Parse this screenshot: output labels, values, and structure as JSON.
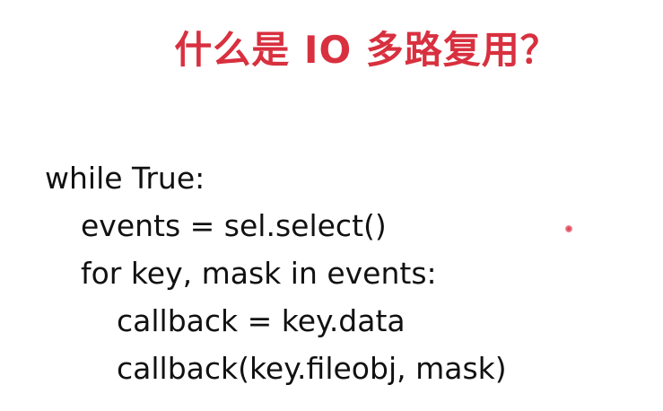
{
  "slide": {
    "title": "什么是 IO 多路复用？",
    "code_lines": [
      "while True:",
      "events = sel.select()",
      "for key, mask in events:",
      "callback = key.data",
      "callback(key.fileobj, mask)"
    ],
    "colors": {
      "title": "#d8303f",
      "text": "#111111",
      "background": "#ffffff",
      "pointer": "#e0304a"
    }
  }
}
